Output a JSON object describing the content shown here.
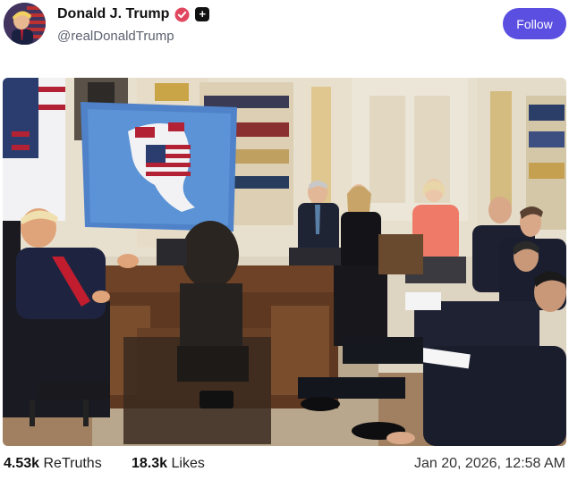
{
  "post": {
    "display_name": "Donald J. Trump",
    "handle": "@realDonaldTrump",
    "follow_label": "Follow",
    "badges": [
      "verified-icon",
      "plus-badge-icon"
    ],
    "image_alt_icon": "photo-oval-office-meeting"
  },
  "stats": {
    "retruths_count": "4.53k",
    "retruths_label": "ReTruths",
    "likes_count": "18.3k",
    "likes_label": "Likes",
    "timestamp": "Jan 20, 2026, 12:58 AM"
  },
  "colors": {
    "follow_button": "#5a4fe0",
    "verified": "#e0475f"
  }
}
